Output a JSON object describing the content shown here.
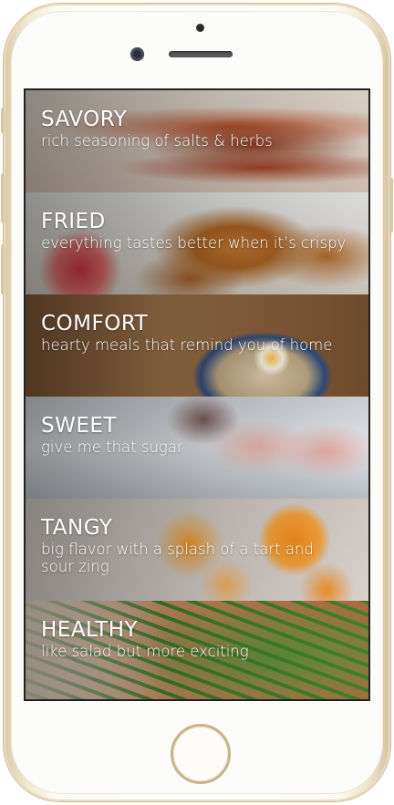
{
  "app": {
    "categories": [
      {
        "title": "SAVORY",
        "subtitle": "rich seasoning of salts & herbs"
      },
      {
        "title": "FRIED",
        "subtitle": "everything tastes better when it’s crispy"
      },
      {
        "title": "COMFORT",
        "subtitle": "hearty meals that remind you of home"
      },
      {
        "title": "SWEET",
        "subtitle": "give me that sugar"
      },
      {
        "title": "TANGY",
        "subtitle": "big flavor with a splash of a tart and sour zing"
      },
      {
        "title": "HEALTHY",
        "subtitle": "like salad but more exciting"
      }
    ]
  },
  "colors": {
    "device_frame": "#f1e8d3",
    "screen_bg": "#111111",
    "text": "#ffffff"
  },
  "icons": [
    "home-button",
    "front-camera",
    "earpiece-speaker"
  ]
}
